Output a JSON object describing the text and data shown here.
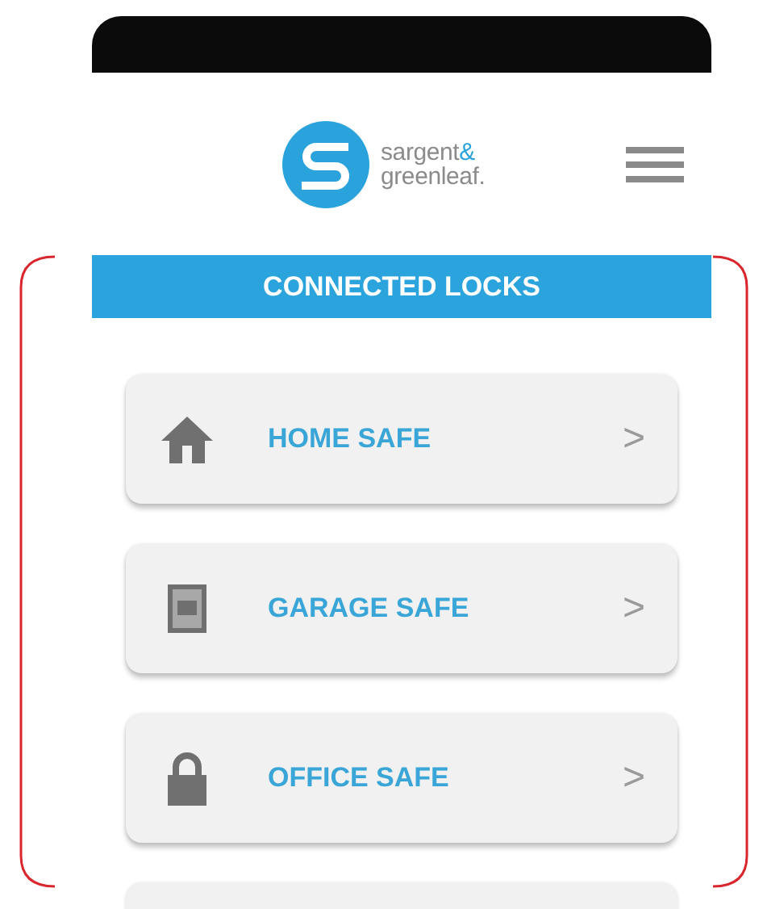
{
  "logo": {
    "line_1": "sargent",
    "ampersand": "&",
    "line_2": "greenleaf."
  },
  "section": {
    "title": "CONNECTED LOCKS"
  },
  "locks": [
    {
      "label": "HOME SAFE",
      "kind": "house",
      "chevron": ">"
    },
    {
      "label": "GARAGE SAFE",
      "kind": "safe",
      "chevron": ">"
    },
    {
      "label": "OFFICE SAFE",
      "kind": "lock",
      "chevron": ">"
    }
  ]
}
